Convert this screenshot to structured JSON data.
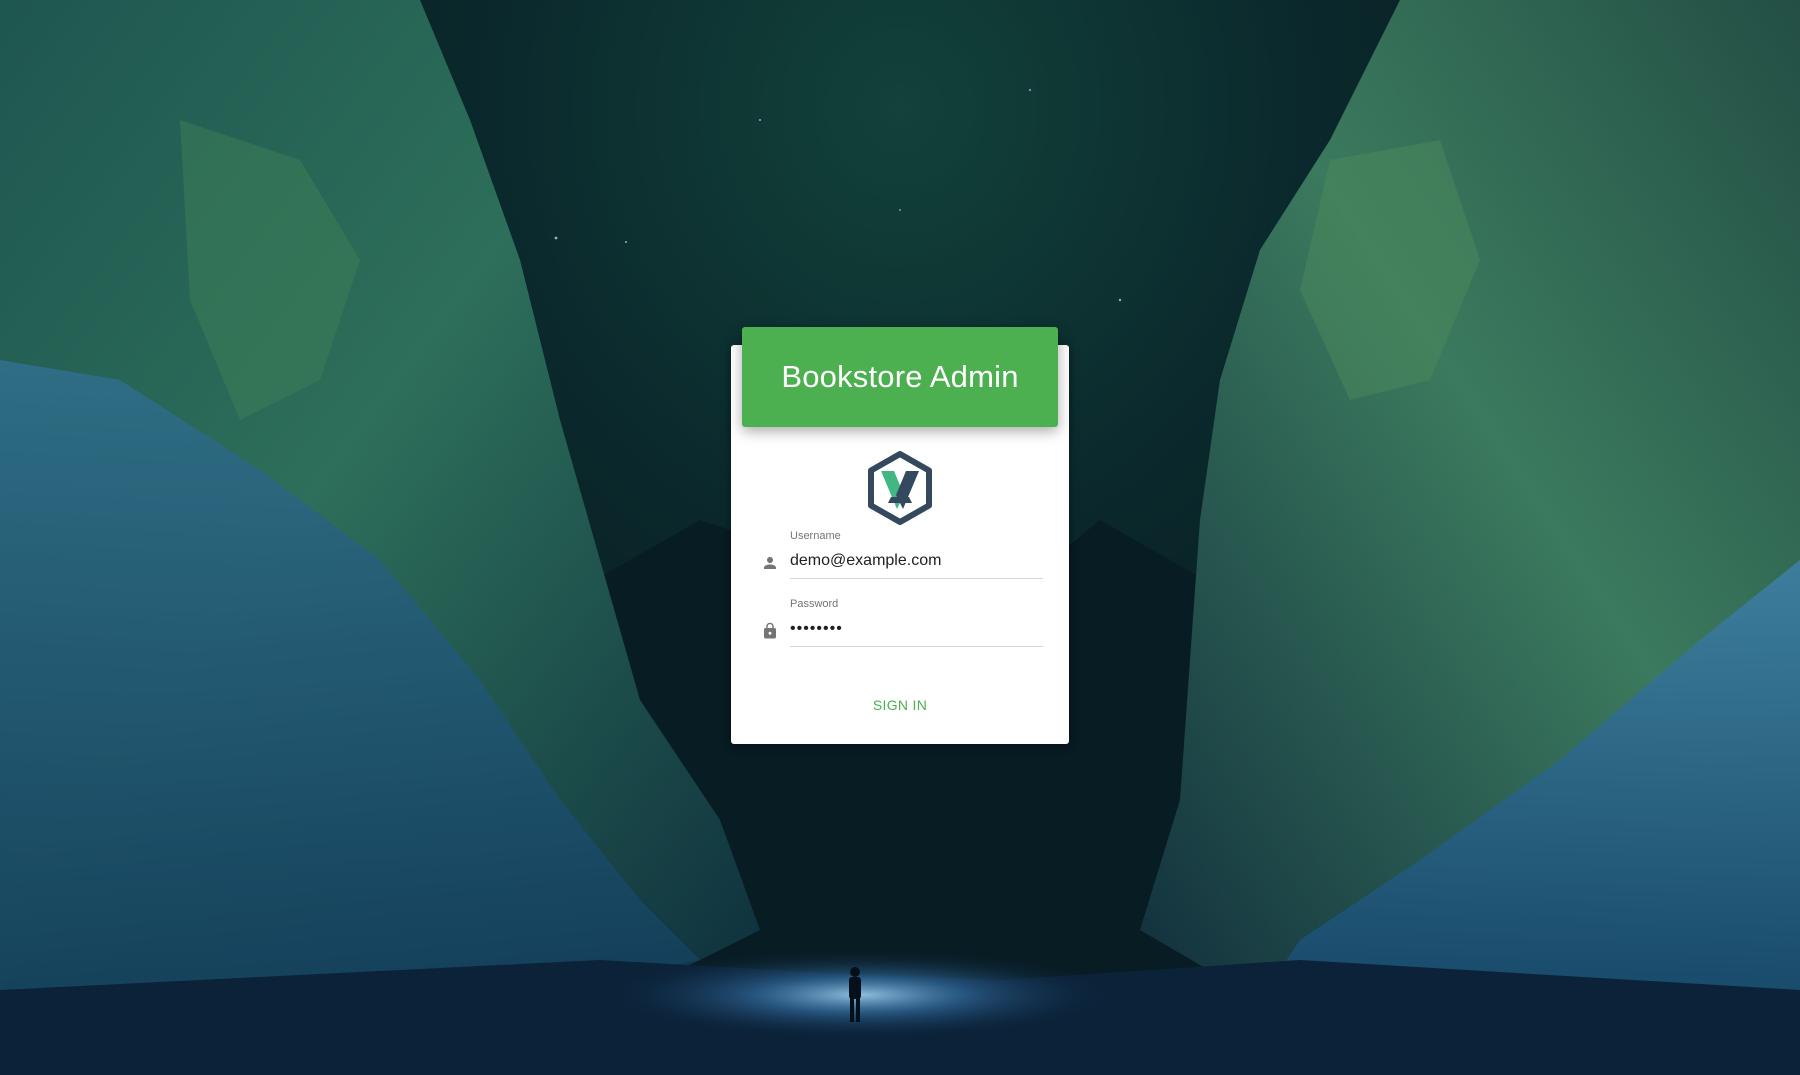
{
  "app": {
    "title": "Bookstore Admin"
  },
  "logo": {
    "icon": "hexagon-va-logo",
    "colors": {
      "hex": "#35495e",
      "accent": "#41b883"
    }
  },
  "form": {
    "username": {
      "label": "Username",
      "value": "demo@example.com",
      "icon": "person-icon"
    },
    "password": {
      "label": "Password",
      "value": "••••••••",
      "icon": "lock-icon"
    },
    "submit_label": "SIGN IN"
  },
  "theme": {
    "primary": "#4caf50",
    "card_background": "#ffffff"
  }
}
